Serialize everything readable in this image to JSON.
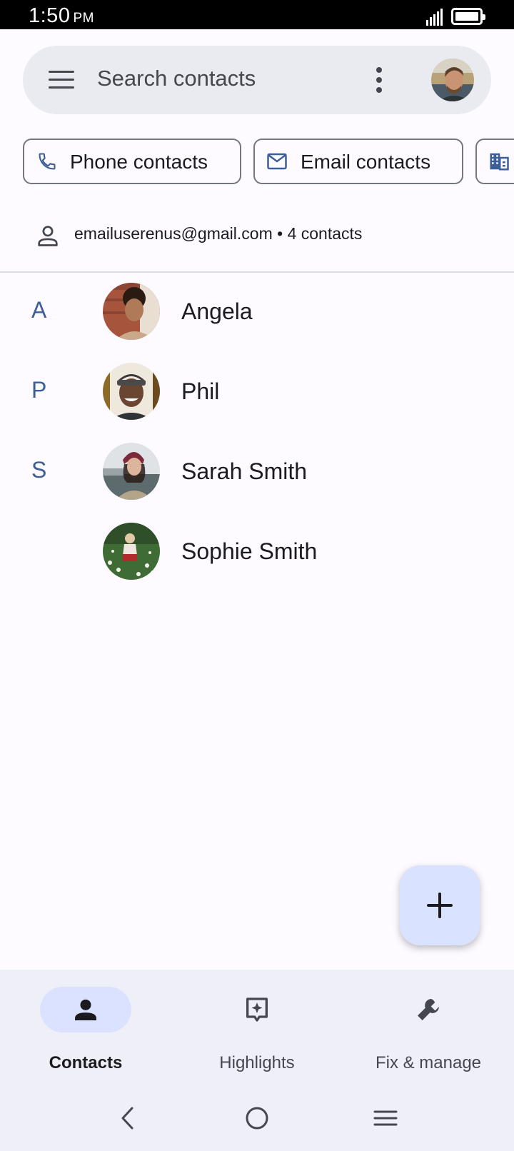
{
  "status_bar": {
    "time": "1:50",
    "ampm": "PM"
  },
  "search": {
    "placeholder": "Search contacts"
  },
  "filters": [
    {
      "label": "Phone contacts",
      "icon": "phone-icon"
    },
    {
      "label": "Email contacts",
      "icon": "mail-icon"
    },
    {
      "label": "",
      "icon": "business-icon"
    }
  ],
  "account": {
    "email": "emailuserenus@gmail.com",
    "count": "4 contacts",
    "separator": "•"
  },
  "sections": [
    {
      "letter": "A"
    },
    {
      "letter": "P"
    },
    {
      "letter": "S"
    }
  ],
  "contacts": [
    {
      "name": "Angela"
    },
    {
      "name": "Phil"
    },
    {
      "name": "Sarah Smith"
    },
    {
      "name": "Sophie Smith"
    }
  ],
  "bottom_nav": [
    {
      "label": "Contacts",
      "icon": "person-icon",
      "active": true
    },
    {
      "label": "Highlights",
      "icon": "sparkle-icon",
      "active": false
    },
    {
      "label": "Fix & manage",
      "icon": "wrench-icon",
      "active": false
    }
  ],
  "colors": {
    "accent": "#3d5f98",
    "fab": "#d9e2ff",
    "nav_active": "#dae2ff",
    "surface": "#eaeaf1"
  }
}
